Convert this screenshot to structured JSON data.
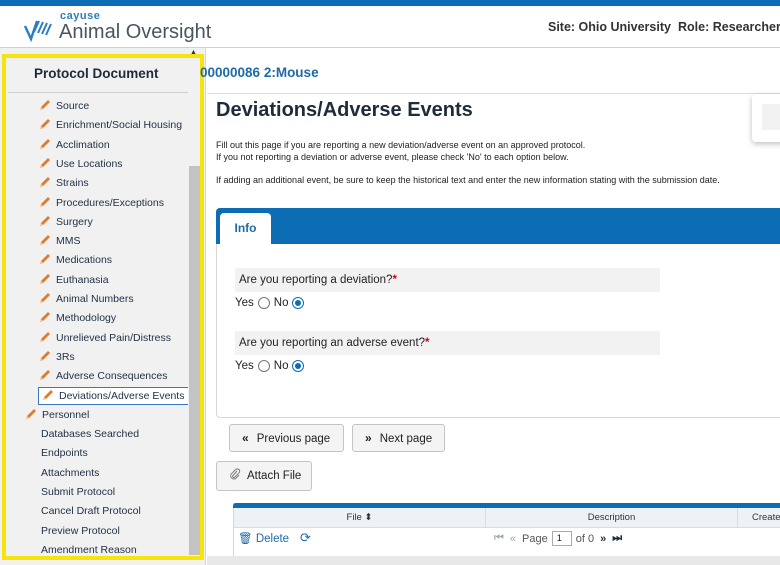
{
  "header": {
    "brand_small": "cayuse",
    "brand_main": "Animal Oversight",
    "site_text": "Site: Ohio University",
    "role_text": "Role: Researcher Staff"
  },
  "sidebar": {
    "title": "Protocol Document",
    "items": [
      {
        "label": "Source",
        "icon": "pencil-icon"
      },
      {
        "label": "Enrichment/Social Housing",
        "icon": "pencil-icon"
      },
      {
        "label": "Acclimation",
        "icon": "pencil-icon"
      },
      {
        "label": "Use Locations",
        "icon": "pencil-icon"
      },
      {
        "label": "Strains",
        "icon": "pencil-icon"
      },
      {
        "label": "Procedures/Exceptions",
        "icon": "pencil-icon"
      },
      {
        "label": "Surgery",
        "icon": "pencil-icon"
      },
      {
        "label": "MMS",
        "icon": "pencil-icon"
      },
      {
        "label": "Medications",
        "icon": "pencil-icon"
      },
      {
        "label": "Euthanasia",
        "icon": "pencil-icon"
      },
      {
        "label": "Animal Numbers",
        "icon": "pencil-icon"
      },
      {
        "label": "Methodology",
        "icon": "pencil-icon"
      },
      {
        "label": "Unrelieved Pain/Distress",
        "icon": "pencil-icon"
      },
      {
        "label": "3Rs",
        "icon": "pencil-icon"
      },
      {
        "label": "Adverse Consequences",
        "icon": "pencil-icon"
      },
      {
        "label": "Deviations/Adverse Events",
        "icon": "pencil-icon"
      },
      {
        "label": "Personnel",
        "icon": "pencil-icon"
      },
      {
        "label": "Databases Searched"
      },
      {
        "label": "Endpoints"
      },
      {
        "label": "Attachments"
      },
      {
        "label": "Submit Protocol"
      },
      {
        "label": "Cancel Draft Protocol"
      },
      {
        "label": "Preview Protocol"
      },
      {
        "label": "Amendment Reason"
      }
    ],
    "highlight_color": "#f5e50a"
  },
  "protocol_id": "00000086 2:Mouse",
  "main": {
    "title": "Deviations/Adverse Events",
    "intro_line1": "Fill out this page if you are reporting a new deviation/adverse event on an approved protocol.",
    "intro_line2": "If you not reporting a deviation or adverse event, please check 'No' to each option below.",
    "intro_line3": "If adding an additional event, be sure to keep the historical text and enter the new information stating with the submission date.",
    "tab_label": "Info",
    "questions": [
      {
        "text": "Are you reporting a deviation?",
        "required_mark": "*",
        "yes_label": "Yes",
        "no_label": "No",
        "selected": "No"
      },
      {
        "text": "Are you reporting an adverse event?",
        "required_mark": "*",
        "yes_label": "Yes",
        "no_label": "No",
        "selected": "No"
      }
    ],
    "prev_button": "Previous page",
    "next_button": "Next page",
    "attach_button": "Attach File"
  },
  "grid": {
    "columns": [
      "File",
      "Description",
      "Created"
    ],
    "delete_label": "Delete",
    "page_label": "Page",
    "page_value": "1",
    "of_label": "of 0"
  },
  "colors": {
    "accent": "#0c6db4",
    "link": "#1e6aa8",
    "required": "#d0021b"
  }
}
